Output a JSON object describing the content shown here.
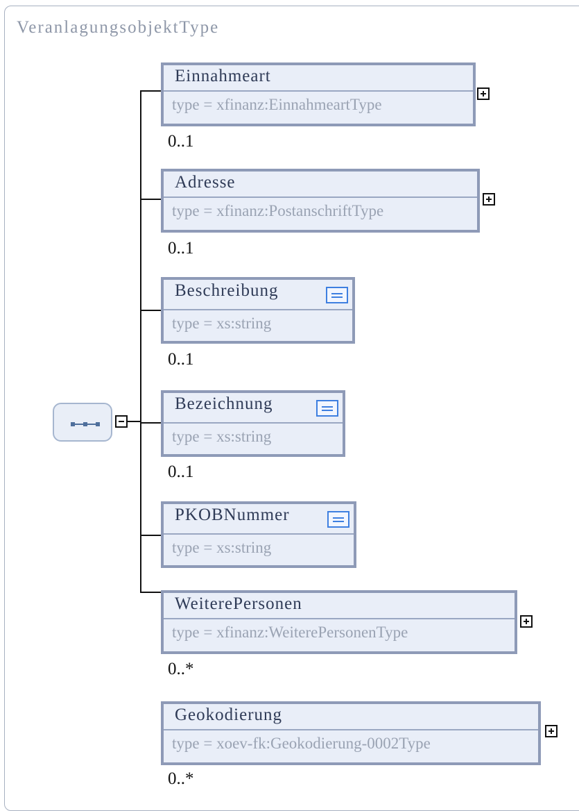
{
  "diagram": {
    "title": "VeranlagungsobjektType",
    "elements": [
      {
        "name": "Einnahmeart",
        "type": "type = xfinanz:EinnahmeartType",
        "occurrence": "0..1",
        "has_children": true,
        "documented": false
      },
      {
        "name": "Adresse",
        "type": "type = xfinanz:PostanschriftType",
        "occurrence": "0..1",
        "has_children": true,
        "documented": false
      },
      {
        "name": "Beschreibung",
        "type": "type = xs:string",
        "occurrence": "0..1",
        "has_children": false,
        "documented": true
      },
      {
        "name": "Bezeichnung",
        "type": "type = xs:string",
        "occurrence": "0..1",
        "has_children": false,
        "documented": true
      },
      {
        "name": "PKOBNummer",
        "type": "type = xs:string",
        "occurrence": "",
        "has_children": false,
        "documented": true
      },
      {
        "name": "WeiterePersonen",
        "type": "type = xfinanz:WeiterePersonenType",
        "occurrence": "0..*",
        "has_children": true,
        "documented": false
      },
      {
        "name": "Geokodierung",
        "type": "type = xoev-fk:Geokodierung-0002Type",
        "occurrence": "0..*",
        "has_children": true,
        "documented": false
      }
    ],
    "compositor": "sequence"
  }
}
